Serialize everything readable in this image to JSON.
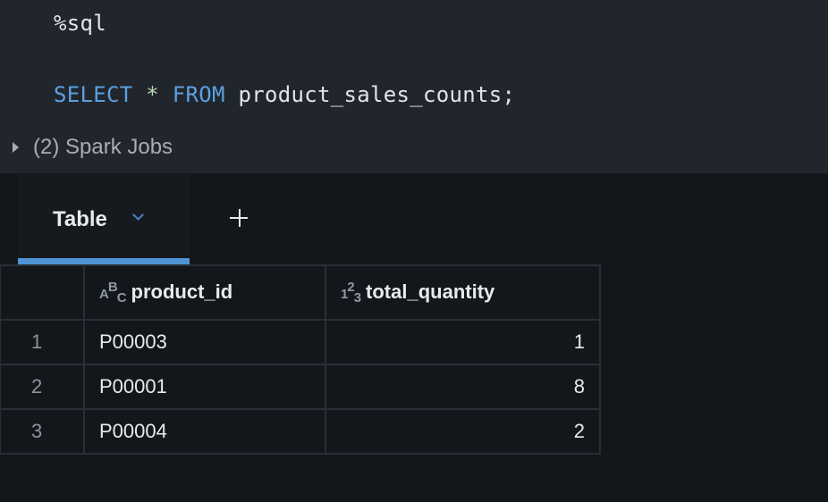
{
  "editor": {
    "magic": "%sql",
    "keyword_select": "SELECT",
    "star": "*",
    "keyword_from": "FROM",
    "table_name": "product_sales_counts;"
  },
  "jobs_label": "(2) Spark Jobs",
  "tab": {
    "label": "Table"
  },
  "table": {
    "columns": [
      {
        "name": "product_id",
        "type_icon": "string-type-icon"
      },
      {
        "name": "total_quantity",
        "type_icon": "number-type-icon"
      }
    ],
    "rows": [
      {
        "n": "1",
        "product_id": "P00003",
        "total_quantity": "1"
      },
      {
        "n": "2",
        "product_id": "P00001",
        "total_quantity": "8"
      },
      {
        "n": "3",
        "product_id": "P00004",
        "total_quantity": "2"
      }
    ]
  }
}
